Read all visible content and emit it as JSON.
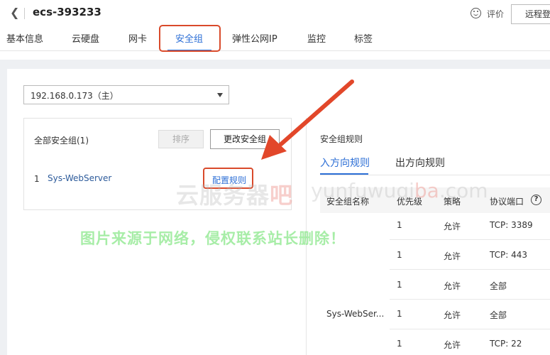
{
  "header": {
    "back_icon": "chevron-left-icon",
    "title": "ecs-393233",
    "feedback_icon": "smile-icon",
    "feedback_label": "评价",
    "remote_login_label": "远程登"
  },
  "tabs": [
    {
      "label": "基本信息"
    },
    {
      "label": "云硬盘"
    },
    {
      "label": "网卡"
    },
    {
      "label": "安全组",
      "active": true
    },
    {
      "label": "弹性公网IP"
    },
    {
      "label": "监控"
    },
    {
      "label": "标签"
    }
  ],
  "nic_select": {
    "value": "192.168.0.173（主）"
  },
  "security_groups": {
    "heading": "全部安全组(1)",
    "sort_label": "排序",
    "change_label": "更改安全组",
    "items": [
      {
        "index": "1",
        "name": "Sys-WebServer",
        "action": "配置规则"
      }
    ]
  },
  "rules": {
    "title": "安全组规则",
    "tabs": [
      {
        "label": "入方向规则",
        "active": true
      },
      {
        "label": "出方向规则"
      }
    ],
    "columns": [
      "安全组名称",
      "优先级",
      "策略",
      "协议端口"
    ],
    "help_icon": "question-circle-icon",
    "group_name": "Sys-WebSer...",
    "rows": [
      {
        "priority": "1",
        "policy": "允许",
        "port": "TCP: 3389"
      },
      {
        "priority": "1",
        "policy": "允许",
        "port": "TCP: 443"
      },
      {
        "priority": "1",
        "policy": "允许",
        "port": "全部"
      },
      {
        "priority": "1",
        "policy": "允许",
        "port": "全部"
      },
      {
        "priority": "1",
        "policy": "允许",
        "port": "TCP: 22"
      }
    ]
  },
  "watermark": {
    "text_gray": "云服务器",
    "text_red": "吧",
    "url_gray": "yunfuwuqi",
    "url_red": "ba",
    "url_tail": ".com",
    "notice": "图片来源于网络，侵权联系站长删除！"
  },
  "colors": {
    "accent": "#2d6fd6",
    "highlight_red": "#d94a2b",
    "notice_green": "#82e682"
  }
}
